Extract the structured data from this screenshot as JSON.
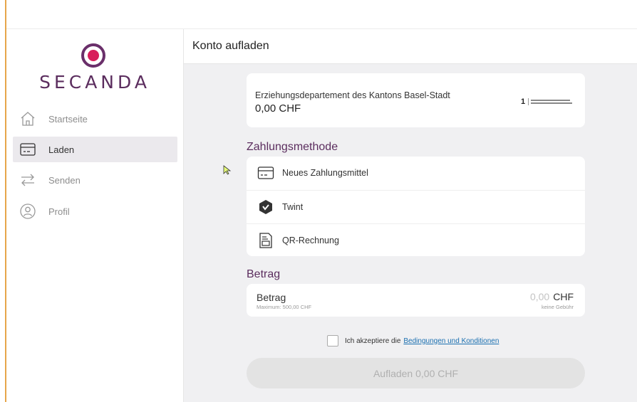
{
  "brand": {
    "name": "SECANDA"
  },
  "sidebar": {
    "items": [
      {
        "label": "Startseite",
        "icon": "home-icon",
        "active": false
      },
      {
        "label": "Laden",
        "icon": "card-icon",
        "active": true
      },
      {
        "label": "Senden",
        "icon": "transfer-icon",
        "active": false
      },
      {
        "label": "Profil",
        "icon": "profile-icon",
        "active": false
      }
    ]
  },
  "page": {
    "title": "Konto aufladen"
  },
  "account": {
    "org_name": "Erziehungsdepartement des Kantons Basel-Stadt",
    "balance": "0,00 CHF",
    "org_logo_mark": "1"
  },
  "payment_methods": {
    "title": "Zahlungsmethode",
    "items": [
      {
        "label": "Neues Zahlungsmittel",
        "icon": "credit-card-icon"
      },
      {
        "label": "Twint",
        "icon": "twint-icon"
      },
      {
        "label": "QR-Rechnung",
        "icon": "qr-invoice-icon"
      }
    ]
  },
  "amount": {
    "section_title": "Betrag",
    "label": "Betrag",
    "max": "Maximum: 500,00 CHF",
    "value": "0,00",
    "currency": "CHF",
    "fee": "keine Gebühr"
  },
  "terms": {
    "prefix": "Ich akzeptiere die",
    "link": "Bedingungen und Konditionen",
    "checked": false
  },
  "submit": {
    "label": "Aufladen 0,00 CHF"
  },
  "colors": {
    "brand": "#5b2d5e",
    "link": "#1a6fb0",
    "active_nav": "#ebe9ed",
    "background": "#f0f0f2"
  }
}
